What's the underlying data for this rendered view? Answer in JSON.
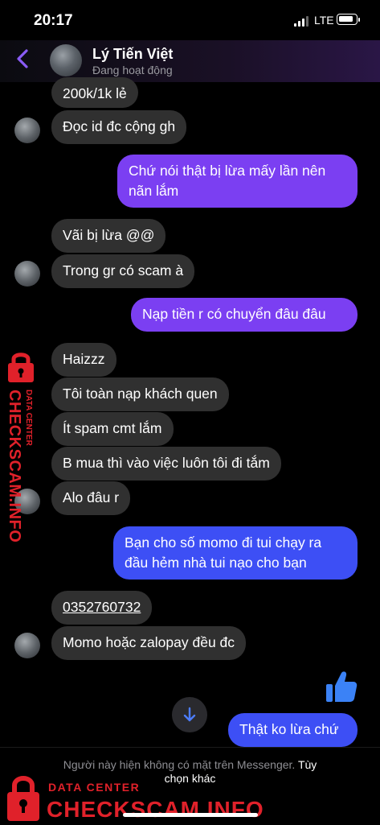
{
  "status_bar": {
    "time": "20:17",
    "network": "LTE"
  },
  "header": {
    "contact_name": "Lý Tiến Việt",
    "contact_status": "Đang hoạt động"
  },
  "messages": [
    {
      "side": "in",
      "text": "200k/1k lẻ"
    },
    {
      "side": "in",
      "text": "Đọc id đc cộng gh"
    },
    {
      "side": "out",
      "text": "Chứ nói thật bị lừa mấy lần nên nãn lắm"
    },
    {
      "side": "in",
      "text": "Vãi bị lừa @@"
    },
    {
      "side": "in",
      "text": "Trong gr có scam à"
    },
    {
      "side": "out",
      "text": "Nạp tiền r có chuyển đâu đâu"
    },
    {
      "side": "in",
      "text": "Haizzz"
    },
    {
      "side": "in",
      "text": "Tôi toàn nạp khách quen"
    },
    {
      "side": "in",
      "text": "Ít spam cmt lắm"
    },
    {
      "side": "in",
      "text": "B mua thì vào việc luôn tôi đi tắm"
    },
    {
      "side": "in",
      "text": "Alo đâu r"
    },
    {
      "side": "out",
      "text": "Bạn cho số momo đi tui chạy ra đầu hẻm nhà tui nạo cho bạn"
    },
    {
      "side": "in",
      "text": "0352760732"
    },
    {
      "side": "in",
      "text": "Momo hoặc zalopay đều đc"
    },
    {
      "side": "out",
      "text": "Thật ko lừa chứ"
    }
  ],
  "footer": {
    "notice": "Người này hiện không có mặt trên Messenger.",
    "link_part1": "Tùy",
    "link_part2": "chọn khác"
  },
  "watermark": {
    "line1": "DATA CENTER",
    "line2": "CHECKSCAM.INFO"
  },
  "colors": {
    "accent": "#7b3ff2",
    "outgoing_blue": "#3d4ff5",
    "incoming": "#303030",
    "watermark": "#e0212a"
  },
  "icons": [
    "back-chevron-icon",
    "like-thumb-icon",
    "scroll-down-arrow-icon",
    "lock-icon"
  ]
}
